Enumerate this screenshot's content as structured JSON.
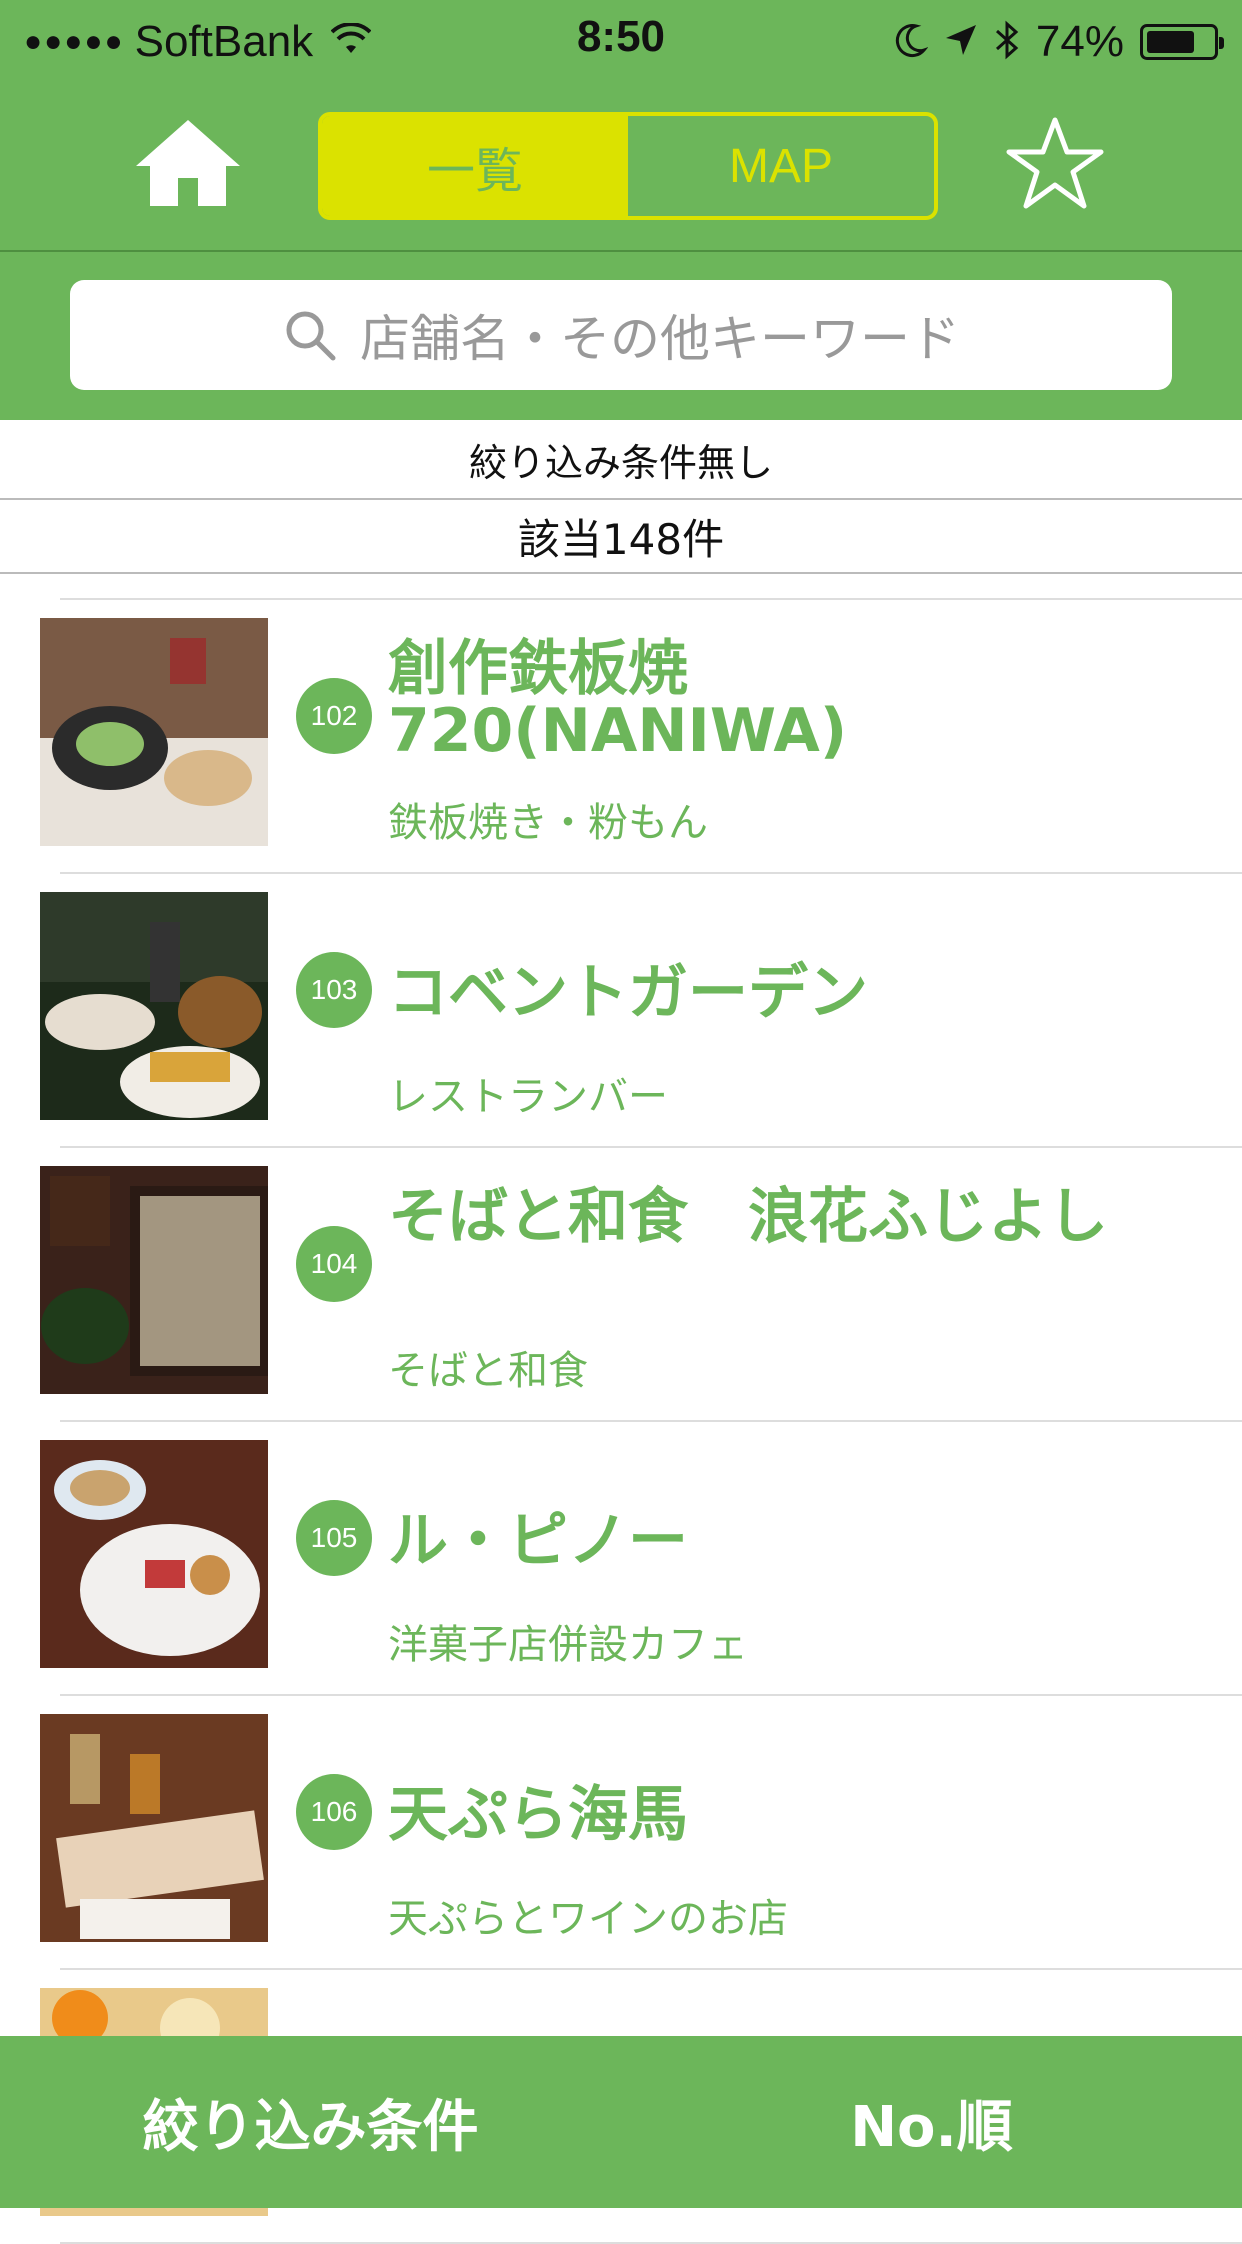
{
  "status_bar": {
    "signal_dots": "●●●●●",
    "carrier": "SoftBank",
    "time": "8:50",
    "battery_percent": "74%",
    "battery_level": 0.74
  },
  "nav": {
    "home_icon": "home-icon",
    "segments": [
      "一覧",
      "MAP"
    ],
    "active_segment": 0,
    "star_icon": "star-icon"
  },
  "search": {
    "placeholder": "店舗名・その他キーワード"
  },
  "filter": {
    "condition_text": "絞り込み条件無し",
    "count_text": "該当148件"
  },
  "items": [
    {
      "number": "102",
      "title": "創作鉄板焼\n720(NANIWA)",
      "category": "鉄板焼き・粉もん"
    },
    {
      "number": "103",
      "title": "コベントガーデン",
      "category": "レストランバー"
    },
    {
      "number": "104",
      "title": "そばと和食　浪花ふじよし",
      "category": "そばと和食"
    },
    {
      "number": "105",
      "title": "ル・ピノー",
      "category": "洋菓子店併設カフェ"
    },
    {
      "number": "106",
      "title": "天ぷら海馬",
      "category": "天ぷらとワインのお店"
    }
  ],
  "bottom_bar": {
    "filter_label": "絞り込み条件",
    "sort_label": "No.順"
  },
  "colors": {
    "brand_green": "#6cb65a",
    "segment_yellow": "#dbe200"
  }
}
